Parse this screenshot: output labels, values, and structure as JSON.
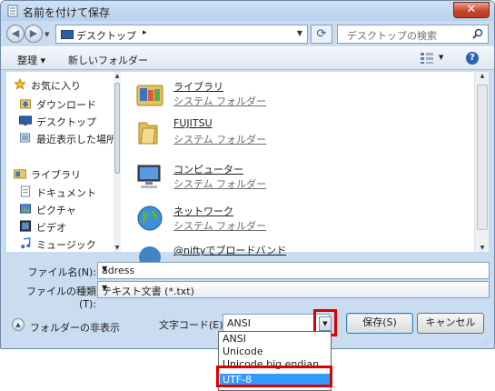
{
  "window": {
    "title": "名前を付けて保存",
    "close_label": "✕"
  },
  "address_bar": {
    "location": "デスクトップ",
    "separator": "▸",
    "search_placeholder": "デスクトップの検索"
  },
  "toolbar": {
    "organize": "整理 ▾",
    "new_folder": "新しいフォルダー",
    "help": "?"
  },
  "navigation": {
    "favorites_header": "お気に入り",
    "favorites": [
      "ダウンロード",
      "デスクトップ",
      "最近表示した場所"
    ],
    "libraries_header": "ライブラリ",
    "libraries": [
      "ドキュメント",
      "ピクチャ",
      "ビデオ",
      "ミュージック"
    ]
  },
  "files": [
    {
      "name": "ライブラリ",
      "type": "システム フォルダー",
      "icon": "library-icon"
    },
    {
      "name": "FUJITSU",
      "type": "システム フォルダー",
      "icon": "user-folder-icon"
    },
    {
      "name": "コンピューター",
      "type": "システム フォルダー",
      "icon": "computer-icon"
    },
    {
      "name": "ネットワーク",
      "type": "システム フォルダー",
      "icon": "network-icon"
    },
    {
      "name": "@niftyでブロードバンド",
      "type": "",
      "icon": "shortcut-icon"
    }
  ],
  "form": {
    "filename_label": "ファイル名(N):",
    "filename_value": "adress",
    "filetype_label": "ファイルの種類(T):",
    "filetype_value": "テキスト文書 (*.txt)",
    "hide_folders": "フォルダーの非表示",
    "encoding_label": "文字コード(E):",
    "encoding_value": "ANSI",
    "save_label": "保存(S)",
    "cancel_label": "キャンセル"
  },
  "encoding_options": [
    "ANSI",
    "Unicode",
    "Unicode big endian",
    "UTF-8"
  ],
  "selected_encoding_index": 3,
  "colors": {
    "highlight_red": "#e00000",
    "selection_blue": "#3399ff"
  }
}
